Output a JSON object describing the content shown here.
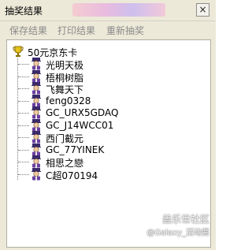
{
  "window": {
    "title": "抽奖结果",
    "close_symbol": "×"
  },
  "menu": [
    "保存结果",
    "打印结果",
    "重新抽奖"
  ],
  "tree": {
    "root": {
      "label": "50元京东卡",
      "icon": "trophy-icon"
    },
    "items": [
      {
        "label": "光明天极",
        "icon": "user-icon"
      },
      {
        "label": "梧桐树脂",
        "icon": "user-icon"
      },
      {
        "label": "飞舞天下",
        "icon": "user-icon"
      },
      {
        "label": "feng0328",
        "icon": "user-icon"
      },
      {
        "label": "GC_URX5GDAQ",
        "icon": "user-icon"
      },
      {
        "label": "GC_J14WCC01",
        "icon": "user-icon"
      },
      {
        "label": "西门截元",
        "icon": "user-icon"
      },
      {
        "label": "GC_77YINEK",
        "icon": "user-icon"
      },
      {
        "label": "相思之戀",
        "icon": "user-icon"
      },
      {
        "label": "C超070194",
        "icon": "user-icon"
      }
    ]
  },
  "watermark": {
    "line1": "盖乐世社区",
    "line2": "@Galaxy_活动酱"
  }
}
